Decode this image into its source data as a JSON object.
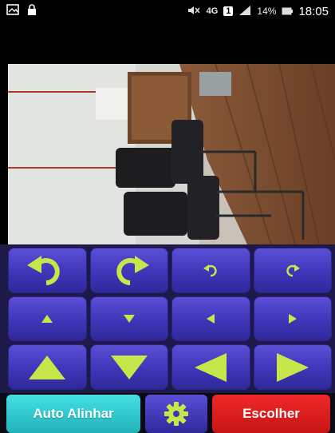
{
  "status_bar": {
    "network": "4G",
    "sim_slot": "1",
    "battery": "14%",
    "time": "18:05"
  },
  "camera_preview": {
    "icon": "camera-feed"
  },
  "controls": {
    "accent_color": "#c6e64a",
    "button_color": "#3f35b8",
    "rows": [
      [
        "rotate-left-large-icon",
        "rotate-right-large-icon",
        "rotate-left-small-icon",
        "rotate-right-small-icon"
      ],
      [
        "arrow-up-small-icon",
        "arrow-down-small-icon",
        "arrow-left-small-icon",
        "arrow-right-small-icon"
      ],
      [
        "arrow-up-large-icon",
        "arrow-down-large-icon",
        "arrow-left-large-icon",
        "arrow-right-large-icon"
      ]
    ]
  },
  "bottom_bar": {
    "auto_align_label": "Auto Alinhar",
    "settings_icon": "gear-icon",
    "choose_label": "Escolher",
    "auto_align_color": "#2cc8cc",
    "choose_color": "#e21e1e"
  }
}
